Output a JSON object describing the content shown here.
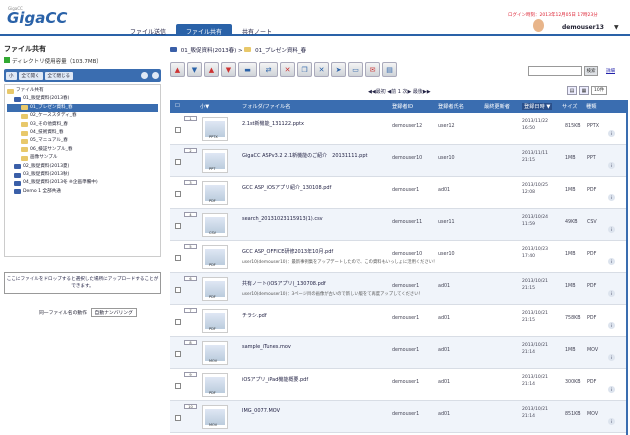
{
  "app": {
    "logo": "GigaCC",
    "logo_sub": "GigaCC"
  },
  "nav": {
    "tabs": [
      "ファイル送信",
      "ファイル共有",
      "共有ノート"
    ],
    "active": 1
  },
  "user": {
    "login_info": "ログイン時刻：2013年12月05日 17時23分",
    "name": "demouser13",
    "dropdown": "▼"
  },
  "left": {
    "title": "ファイル共有",
    "quota": "ディレクトリ使用容量（103.7MB）",
    "buttons": [
      "小",
      "全て開く",
      "全て閉じる"
    ],
    "tree": [
      {
        "label": "ファイル共有",
        "level": 0
      },
      {
        "label": "01_販促資料(2013春)",
        "level": 1
      },
      {
        "label": "01_プレゼン資料_春",
        "level": 2,
        "selected": true
      },
      {
        "label": "02_ケーススタディ_春",
        "level": 2
      },
      {
        "label": "03_その他資料_春",
        "level": 2
      },
      {
        "label": "04_技術資料_春",
        "level": 2
      },
      {
        "label": "05_マニュアル_春",
        "level": 2
      },
      {
        "label": "06_検証サンプル_春",
        "level": 2
      },
      {
        "label": "画像サンプル",
        "level": 2
      },
      {
        "label": "02_販促資料(2013夏)",
        "level": 1
      },
      {
        "label": "03_販促資料(2013秋)",
        "level": 1
      },
      {
        "label": "04_販促資料(2013冬 ※企画準備中)",
        "level": 1
      },
      {
        "label": "Demo 1 全部共通",
        "level": 1
      }
    ],
    "drop_text": "ここにファイルをドロップすると選択した場所にアップロードすることができます。",
    "samefile_label": "同一ファイル名の動作",
    "samefile_value": "自動ナンバリング"
  },
  "breadcrumb": {
    "items": [
      "01_販促資料(2013春)",
      "01_プレゼン資料_春"
    ],
    "sep": ">"
  },
  "toolbar": {
    "search_button": "検索",
    "detail_link": "詳細"
  },
  "pager": {
    "text": "◀◀最初 ◀前 1 次▶ 最後▶▶",
    "per_page": "10件"
  },
  "table": {
    "headers": [
      "フォルダ/ファイル名",
      "登録者ID",
      "登録者氏名",
      "最終更新者",
      "登録日時 ▼",
      "サイズ",
      "種類"
    ],
    "rows": [
      {
        "no": "1",
        "name": "2.1st新機能_131122.pptx",
        "comment": "",
        "id": "demouser12",
        "uname": "user12",
        "date1": "2013/11/22",
        "date2": "16:50",
        "size": "815KB",
        "type": "PPTX",
        "thumb": "ppt"
      },
      {
        "no": "2",
        "name": "GigaCC ASPv3.2 2.1新機能のご紹介　20131111.ppt",
        "comment": "",
        "id": "demouser10",
        "uname": "user10",
        "date1": "2013/11/11",
        "date2": "21:15",
        "size": "1MB",
        "type": "PPT",
        "thumb": "ppt"
      },
      {
        "no": "3",
        "name": "GCC ASP_iOSアプリ紹介_130108.pdf",
        "comment": "",
        "id": "demouser1",
        "uname": "ad01",
        "date1": "2013/10/25",
        "date2": "12:08",
        "size": "1MB",
        "type": "PDF",
        "thumb": "pdf"
      },
      {
        "no": "4",
        "name": "search_20131023115913(1).csv",
        "comment": "",
        "id": "demouser11",
        "uname": "user11",
        "date1": "2013/10/24",
        "date2": "11:59",
        "size": "49KB",
        "type": "CSV",
        "thumb": "csv"
      },
      {
        "no": "5",
        "name": "GCC ASP_OFFICE研修2013年10月.pdf",
        "comment": "user10(demouser10)：最新事例集をアップデートしたので、この資料もいっしょに活用ください！",
        "id": "demouser10",
        "uname": "user10",
        "date1": "2013/10/23",
        "date2": "17:40",
        "size": "1MB",
        "type": "PDF",
        "thumb": "pdf"
      },
      {
        "no": "6",
        "name": "共有ノート(iOSアプリ)_130708.pdf",
        "comment": "user10(demouser10)：3ページ目の画像が古いので新しい版をて再度アップしてください！",
        "id": "demouser1",
        "uname": "ad01",
        "date1": "2013/10/21",
        "date2": "21:15",
        "size": "1MB",
        "type": "PDF",
        "thumb": "pdf"
      },
      {
        "no": "7",
        "name": "チラシ.pdf",
        "comment": "",
        "id": "demouser1",
        "uname": "ad01",
        "date1": "2013/10/21",
        "date2": "21:15",
        "size": "758KB",
        "type": "PDF",
        "thumb": "pdf"
      },
      {
        "no": "8",
        "name": "sample_iTunes.mov",
        "comment": "",
        "id": "demouser1",
        "uname": "ad01",
        "date1": "2013/10/21",
        "date2": "21:14",
        "size": "1MB",
        "type": "MOV",
        "thumb": "mov"
      },
      {
        "no": "9",
        "name": "iOSアプリ_iPad機能概要.pdf",
        "comment": "",
        "id": "demouser1",
        "uname": "ad01",
        "date1": "2013/10/21",
        "date2": "21:14",
        "size": "300KB",
        "type": "PDF",
        "thumb": "pdf"
      },
      {
        "no": "10",
        "name": "IMG_0077.MOV",
        "comment": "",
        "id": "demouser1",
        "uname": "ad01",
        "date1": "2013/10/21",
        "date2": "21:14",
        "size": "851KB",
        "type": "MOV",
        "thumb": "mov"
      }
    ]
  }
}
